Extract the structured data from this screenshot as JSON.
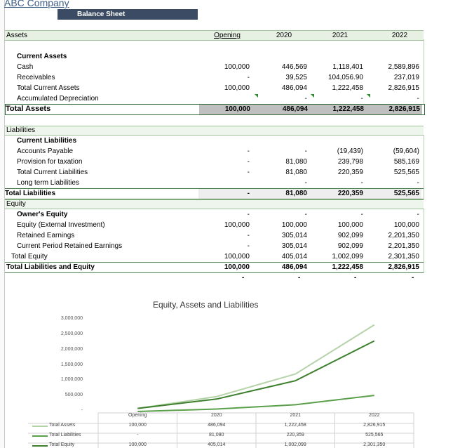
{
  "header": {
    "company": "ABC Company",
    "sheet_title": "Balance Sheet"
  },
  "columns": [
    "Opening",
    "2020",
    "2021",
    "2022"
  ],
  "assets": {
    "section_label": "Assets",
    "current_assets_label": "Current Assets",
    "rows": [
      {
        "label": "Cash",
        "values": [
          "100,000",
          "446,569",
          "1,118,401",
          "2,589,896"
        ]
      },
      {
        "label": "Receivables",
        "values": [
          "-",
          "39,525",
          "104,056.90",
          "237,019"
        ]
      },
      {
        "label": "Total Current Assets",
        "values": [
          "100,000",
          "486,094",
          "1,222,458",
          "2,826,915"
        ]
      },
      {
        "label": "Accumulated Depreciation",
        "values": [
          "",
          "-",
          "-",
          "-"
        ]
      }
    ],
    "total": {
      "label": "Total Assets",
      "values": [
        "100,000",
        "486,094",
        "1,222,458",
        "2,826,915"
      ]
    }
  },
  "liabilities": {
    "section_label": "Liabilities",
    "current_label": "Current Liabilities",
    "rows": [
      {
        "label": "Accounts Payable",
        "values": [
          "-",
          "-",
          "(19,439)",
          "(59,604)"
        ]
      },
      {
        "label": "Provision for taxation",
        "values": [
          "-",
          "81,080",
          "239,798",
          "585,169"
        ]
      },
      {
        "label": "Total Current Liabilities",
        "values": [
          "-",
          "81,080",
          "220,359",
          "525,565"
        ]
      },
      {
        "label": "Long term Liabilities",
        "values": [
          "",
          "-",
          "-",
          "-"
        ]
      }
    ],
    "total": {
      "label": "Total Liabilities",
      "values": [
        "-",
        "81,080",
        "220,359",
        "525,565"
      ]
    }
  },
  "equity": {
    "section_label": "Equity",
    "owners_label": "Owner's Equity",
    "rows": [
      {
        "label": "Equity  (External Investment)",
        "values": [
          "100,000",
          "100,000",
          "100,000",
          "100,000"
        ]
      },
      {
        "label": "Retained Earnings",
        "values": [
          "-",
          "305,014",
          "902,099",
          "2,201,350"
        ]
      },
      {
        "label": "Current Period Retained Earnings",
        "values": [
          "-",
          "305,014",
          "902,099",
          "2,201,350"
        ]
      }
    ],
    "total_equity": {
      "label": "Total Equity",
      "values": [
        "100,000",
        "405,014",
        "1,002,099",
        "2,301,350"
      ]
    },
    "total_le": {
      "label": "Total Liabilities and Equity",
      "values": [
        "100,000",
        "486,094",
        "1,222,458",
        "2,826,915"
      ]
    }
  },
  "chart_data": {
    "type": "line",
    "title": "Equity, Assets and Liabilities",
    "categories": [
      "Opening",
      "2020",
      "2021",
      "2022"
    ],
    "ylim": [
      0,
      3000000
    ],
    "yticks": [
      "-",
      "500,000",
      "1,000,000",
      "1,500,000",
      "2,000,000",
      "2,500,000",
      "3,000,000"
    ],
    "series": [
      {
        "name": "Total Assets",
        "values": [
          100000,
          486094,
          1222458,
          2826915
        ],
        "labels": [
          "100,000",
          "486,094",
          "1,222,458",
          "2,826,915"
        ],
        "color": "#b5d3a8"
      },
      {
        "name": "Total Liabilities",
        "values": [
          0,
          81080,
          220359,
          525565
        ],
        "labels": [
          "-",
          "81,080",
          "220,359",
          "525,565"
        ],
        "color": "#5aa04a"
      },
      {
        "name": "Total Equity",
        "values": [
          100000,
          405014,
          1002099,
          2301350
        ],
        "labels": [
          "100,000",
          "405,014",
          "1,002,099",
          "2,301,350"
        ],
        "color": "#3e7f2e"
      }
    ],
    "legend": "bottom-table"
  }
}
